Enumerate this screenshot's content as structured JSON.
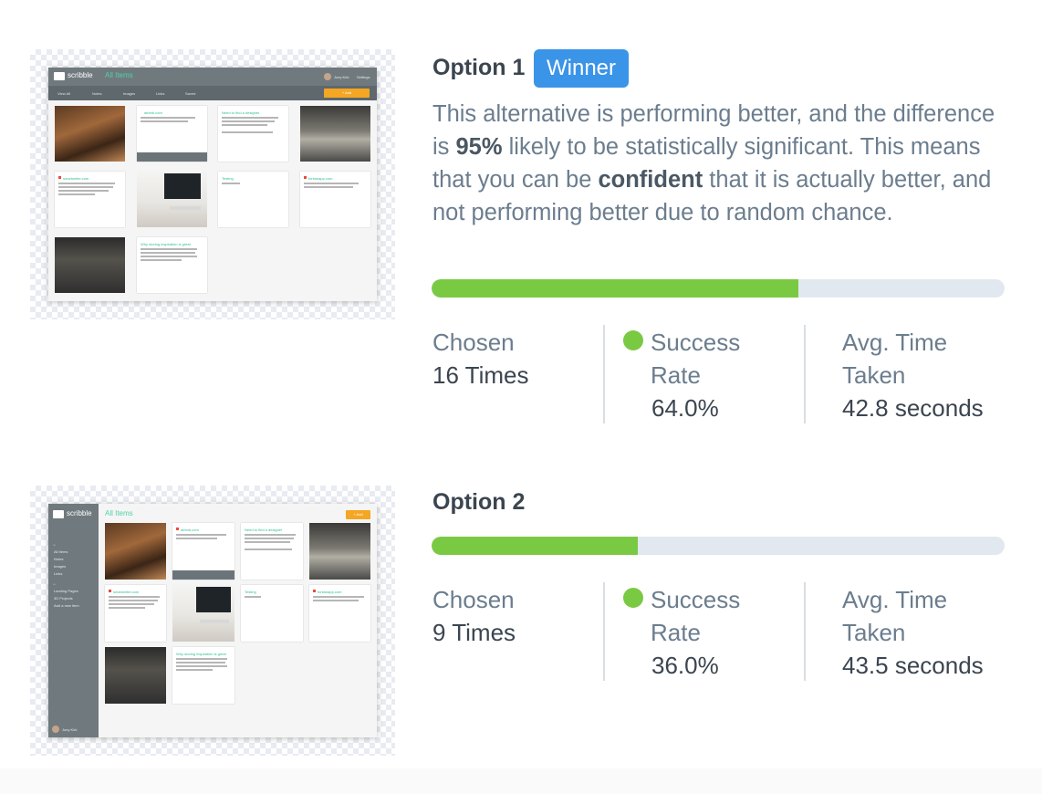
{
  "colors": {
    "winner_badge": "#3a94e8",
    "progress_fill": "#7ac943",
    "progress_track": "#e2e8ef",
    "success_dot": "#7ac943",
    "text_primary": "#3b4550",
    "text_secondary": "#6b7d8e"
  },
  "option1": {
    "title": "Option 1",
    "badge": "Winner",
    "description_parts": {
      "p1": "This alternative is performing better, and the difference is ",
      "b1": "95%",
      "p2": " likely to be statistically significant. This means that you can be ",
      "b2": "confident",
      "p3": " that it is actually better, and not performing better due to random chance."
    },
    "success_fraction": 0.64,
    "stats": {
      "chosen_label": "Chosen",
      "chosen_value": "16 Times",
      "success_label_1": "Success",
      "success_label_2": "Rate",
      "success_value": "64.0%",
      "time_label_1": "Avg. Time",
      "time_label_2": "Taken",
      "time_value": "42.8 seconds"
    },
    "screenshot": {
      "logo": "scribble",
      "title": "All Items",
      "user": "Joey Kirk",
      "settings": "Settings",
      "add": "+ Add",
      "tabs": [
        "View All",
        "Notes",
        "Images",
        "Links",
        "Saved"
      ],
      "card_titles": [
        "airbnb.com",
        "Need to find a designer",
        "smartwriter.com",
        "Testing",
        "fontanapp.com",
        "Why storing inspiration is great"
      ]
    }
  },
  "option2": {
    "title": "Option 2",
    "success_fraction": 0.36,
    "stats": {
      "chosen_label": "Chosen",
      "chosen_value": "9 Times",
      "success_label_1": "Success",
      "success_label_2": "Rate",
      "success_value": "36.0%",
      "time_label_1": "Avg. Time",
      "time_label_2": "Taken",
      "time_value": "43.5 seconds"
    },
    "screenshot": {
      "logo": "scribble",
      "title": "All Items",
      "add": "+ Add",
      "user": "Joey Kirk",
      "sidebar_items": [
        "All Items",
        "Notes",
        "Images",
        "Links",
        "Landing Pages",
        "3D Projects",
        "Add a new item"
      ],
      "card_titles": [
        "airbnb.com",
        "Need to find a designer",
        "smartwriter.com",
        "Testing",
        "fontanapp.com",
        "Why storing inspiration is great"
      ]
    }
  }
}
